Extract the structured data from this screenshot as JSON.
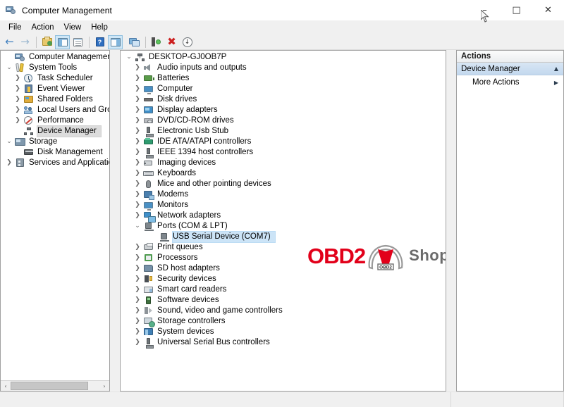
{
  "window": {
    "title": "Computer Management",
    "app_icon": "computer-management-icon",
    "controls": {
      "minimize": "–",
      "maximize": "□",
      "close": "✕"
    }
  },
  "menubar": {
    "items": [
      {
        "label": "File"
      },
      {
        "label": "Action"
      },
      {
        "label": "View"
      },
      {
        "label": "Help"
      }
    ]
  },
  "toolbar": {
    "buttons": [
      {
        "name": "back-icon",
        "glyph": "←",
        "kind": "arrow-left"
      },
      {
        "name": "forward-icon",
        "glyph": "→",
        "kind": "arrow-right"
      },
      {
        "name": "up-one-level-icon",
        "kind": "folder"
      },
      {
        "name": "show-hide-console-tree-icon",
        "kind": "panel",
        "pressed": true
      },
      {
        "name": "properties-icon",
        "kind": "doc"
      },
      {
        "name": "help-icon",
        "kind": "help",
        "glyph": "?"
      },
      {
        "name": "show-action-pane-icon",
        "kind": "panel",
        "pressed": true
      },
      {
        "name": "device-view-icon",
        "kind": "monitor2"
      },
      {
        "name": "scan-for-hardware-changes-icon",
        "kind": "scan"
      },
      {
        "name": "uninstall-device-icon",
        "kind": "x",
        "glyph": "✖"
      },
      {
        "name": "update-driver-icon",
        "kind": "down",
        "glyph": "↓"
      }
    ]
  },
  "console_tree": {
    "items": [
      {
        "label": "Computer Management (Local",
        "icon": "computer-management-icon",
        "indent": 0,
        "twist": "none",
        "state": "normal"
      },
      {
        "label": "System Tools",
        "icon": "system-tools-icon",
        "indent": 0,
        "twist": "expanded",
        "state": "normal"
      },
      {
        "label": "Task Scheduler",
        "icon": "task-scheduler-icon",
        "indent": 1,
        "twist": "collapsed",
        "state": "normal"
      },
      {
        "label": "Event Viewer",
        "icon": "event-viewer-icon",
        "indent": 1,
        "twist": "collapsed",
        "state": "normal"
      },
      {
        "label": "Shared Folders",
        "icon": "shared-folders-icon",
        "indent": 1,
        "twist": "collapsed",
        "state": "normal"
      },
      {
        "label": "Local Users and Groups",
        "icon": "local-users-and-groups-icon",
        "indent": 1,
        "twist": "collapsed",
        "state": "normal"
      },
      {
        "label": "Performance",
        "icon": "performance-icon",
        "indent": 1,
        "twist": "collapsed",
        "state": "normal"
      },
      {
        "label": "Device Manager",
        "icon": "device-manager-icon",
        "indent": 1,
        "twist": "none",
        "state": "selected-inactive"
      },
      {
        "label": "Storage",
        "icon": "storage-icon",
        "indent": 0,
        "twist": "expanded",
        "state": "normal"
      },
      {
        "label": "Disk Management",
        "icon": "disk-management-icon",
        "indent": 1,
        "twist": "none",
        "state": "normal"
      },
      {
        "label": "Services and Applications",
        "icon": "services-and-applications-icon",
        "indent": 0,
        "twist": "collapsed",
        "state": "normal"
      }
    ],
    "hscrollbar": {
      "left_arrow": "‹",
      "right_arrow": "›"
    }
  },
  "device_tree": {
    "items": [
      {
        "label": "DESKTOP-GJ0OB7P",
        "icon": "computer-root-icon",
        "indent": 0,
        "twist": "expanded-root",
        "state": "normal"
      },
      {
        "label": "Audio inputs and outputs",
        "icon": "speaker-icon",
        "indent": 1,
        "twist": "collapsed",
        "state": "normal"
      },
      {
        "label": "Batteries",
        "icon": "battery-icon",
        "indent": 1,
        "twist": "collapsed",
        "state": "normal"
      },
      {
        "label": "Computer",
        "icon": "monitor-icon",
        "indent": 1,
        "twist": "collapsed",
        "state": "normal"
      },
      {
        "label": "Disk drives",
        "icon": "disk-drive-icon",
        "indent": 1,
        "twist": "collapsed",
        "state": "normal"
      },
      {
        "label": "Display adapters",
        "icon": "display-adapter-icon",
        "indent": 1,
        "twist": "collapsed",
        "state": "normal"
      },
      {
        "label": "DVD/CD-ROM drives",
        "icon": "dvd-drive-icon",
        "indent": 1,
        "twist": "collapsed",
        "state": "normal"
      },
      {
        "label": "Electronic Usb Stub",
        "icon": "usb-icon",
        "indent": 1,
        "twist": "collapsed",
        "state": "normal"
      },
      {
        "label": "IDE ATA/ATAPI controllers",
        "icon": "ide-controller-icon",
        "indent": 1,
        "twist": "collapsed",
        "state": "normal"
      },
      {
        "label": "IEEE 1394 host controllers",
        "icon": "usb-icon",
        "indent": 1,
        "twist": "collapsed",
        "state": "normal"
      },
      {
        "label": "Imaging devices",
        "icon": "imaging-device-icon",
        "indent": 1,
        "twist": "collapsed",
        "state": "normal"
      },
      {
        "label": "Keyboards",
        "icon": "keyboard-icon",
        "indent": 1,
        "twist": "collapsed",
        "state": "normal"
      },
      {
        "label": "Mice and other pointing devices",
        "icon": "mouse-icon",
        "indent": 1,
        "twist": "collapsed",
        "state": "normal"
      },
      {
        "label": "Modems",
        "icon": "modem-icon",
        "indent": 1,
        "twist": "collapsed",
        "state": "normal"
      },
      {
        "label": "Monitors",
        "icon": "monitor-icon",
        "indent": 1,
        "twist": "collapsed",
        "state": "normal"
      },
      {
        "label": "Network adapters",
        "icon": "network-adapter-icon",
        "indent": 1,
        "twist": "collapsed",
        "state": "normal"
      },
      {
        "label": "Ports (COM & LPT)",
        "icon": "port-icon",
        "indent": 1,
        "twist": "expanded",
        "state": "normal"
      },
      {
        "label": "USB Serial Device (COM7)",
        "icon": "port-icon",
        "indent": 2,
        "twist": "none",
        "state": "selected-active"
      },
      {
        "label": "Print queues",
        "icon": "printer-icon",
        "indent": 1,
        "twist": "collapsed",
        "state": "normal"
      },
      {
        "label": "Processors",
        "icon": "processor-icon",
        "indent": 1,
        "twist": "collapsed",
        "state": "normal"
      },
      {
        "label": "SD host adapters",
        "icon": "sd-host-adapter-icon",
        "indent": 1,
        "twist": "collapsed",
        "state": "normal"
      },
      {
        "label": "Security devices",
        "icon": "security-device-icon",
        "indent": 1,
        "twist": "collapsed",
        "state": "normal"
      },
      {
        "label": "Smart card readers",
        "icon": "smart-card-reader-icon",
        "indent": 1,
        "twist": "collapsed",
        "state": "normal"
      },
      {
        "label": "Software devices",
        "icon": "software-device-icon",
        "indent": 1,
        "twist": "collapsed",
        "state": "normal"
      },
      {
        "label": "Sound, video and game controllers",
        "icon": "sound-controller-icon",
        "indent": 1,
        "twist": "collapsed",
        "state": "normal"
      },
      {
        "label": "Storage controllers",
        "icon": "storage-controller-icon",
        "indent": 1,
        "twist": "collapsed",
        "state": "normal"
      },
      {
        "label": "System devices",
        "icon": "system-device-icon",
        "indent": 1,
        "twist": "collapsed",
        "state": "normal"
      },
      {
        "label": "Universal Serial Bus controllers",
        "icon": "usb-icon",
        "indent": 1,
        "twist": "collapsed",
        "state": "normal"
      }
    ]
  },
  "actions_pane": {
    "header": "Actions",
    "group": {
      "label": "Device Manager",
      "collapse_glyph": "▲"
    },
    "items": [
      {
        "label": "More Actions",
        "submenu_glyph": "▶"
      }
    ]
  },
  "watermark": {
    "brand_red": "OBD2",
    "brand_grey": "Shop.co.uk",
    "plate_text": "OBD2",
    "colors": {
      "red": "#e2001a",
      "grey": "#6b6b6b"
    }
  },
  "colors": {
    "selection_active": "#cce4f7",
    "selection_inactive": "#dcdcdc",
    "window_chrome": "#f0f0f0",
    "pane_bg": "#ffffff",
    "actions_group": "#c3d8ee"
  }
}
